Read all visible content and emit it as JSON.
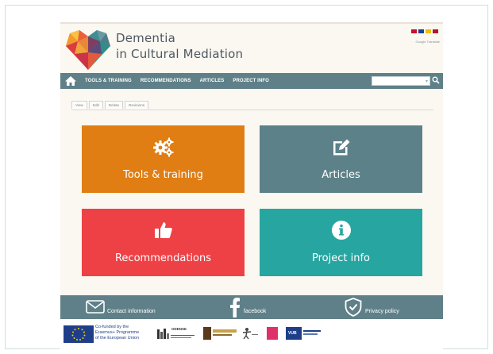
{
  "site": {
    "title_line1": "Dementia",
    "title_line2": "in Cultural Mediation",
    "translate_label": "Google Translate",
    "flags": [
      {
        "name": "danish-flag",
        "color": "#c8102e"
      },
      {
        "name": "british-flag",
        "color": "#1f3e8a"
      },
      {
        "name": "spanish-flag",
        "color": "#f1bf00"
      },
      {
        "name": "dutch-flag",
        "color": "#ae1c28"
      }
    ]
  },
  "nav": {
    "items": [
      "TOOLS & TRAINING",
      "RECOMMENDATIONS",
      "ARTICLES",
      "PROJECT INFO"
    ],
    "search_placeholder": ""
  },
  "tabs": [
    "View",
    "Edit",
    "Delete",
    "Revisions"
  ],
  "tiles": [
    {
      "label": "Tools & training",
      "icon": "gears-icon",
      "color": "#e07e14"
    },
    {
      "label": "Articles",
      "icon": "edit-icon",
      "color": "#5c8189"
    },
    {
      "label": "Recommendations",
      "icon": "thumbs-up-icon",
      "color": "#ee4145"
    },
    {
      "label": "Project info",
      "icon": "info-icon",
      "color": "#27a6a1"
    }
  ],
  "footer": {
    "contact": "Contact information",
    "facebook": "facebook",
    "privacy": "Privacy policy"
  },
  "partners": {
    "eu_line1": "Co-funded by the",
    "eu_line2": "Erasmus+ Programme",
    "eu_line3": "of the European Union",
    "odense": "ODENSE",
    "vub": "VUB"
  },
  "colors": {
    "nav_bg": "#5f8088",
    "page_bg": "#fbf7f1",
    "title_text": "#4d5963"
  }
}
